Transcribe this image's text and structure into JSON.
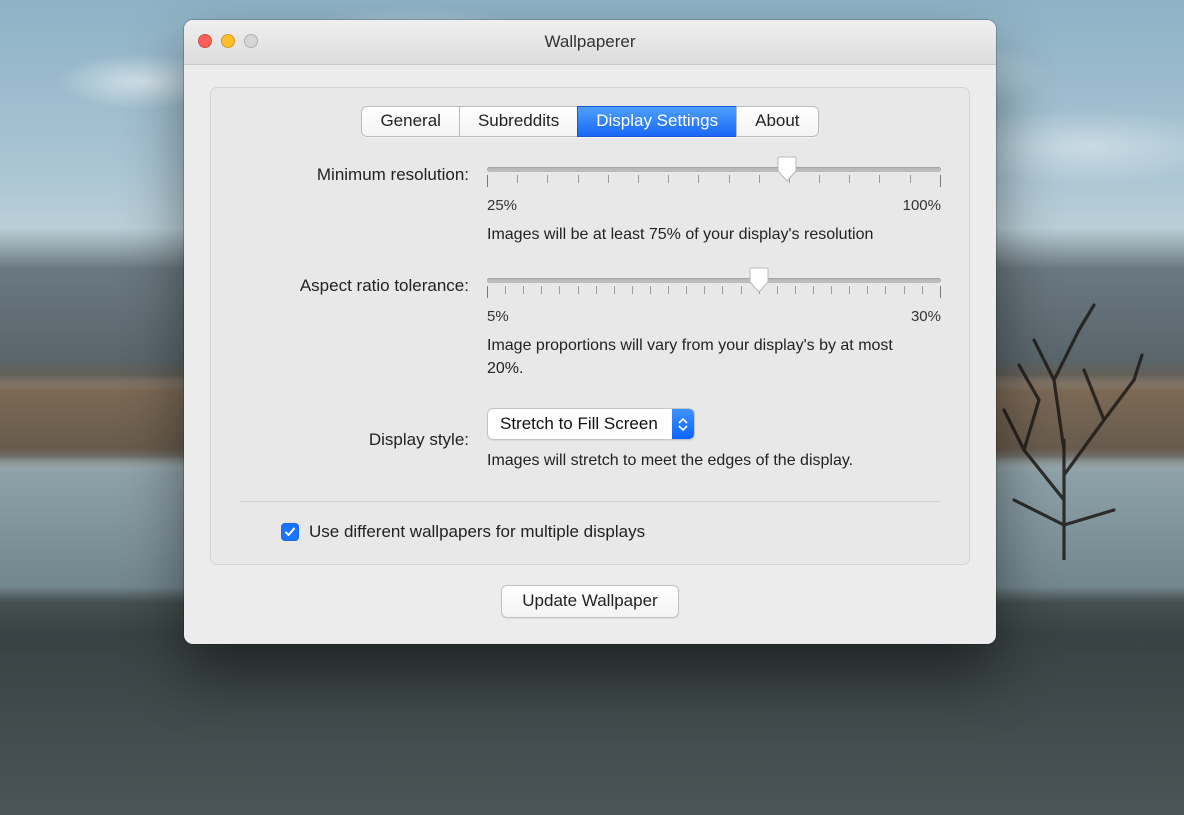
{
  "window": {
    "title": "Wallpaperer"
  },
  "tabs": [
    "General",
    "Subreddits",
    "Display Settings",
    "About"
  ],
  "activeTab": 2,
  "minRes": {
    "label": "Minimum resolution:",
    "minLabel": "25%",
    "maxLabel": "100%",
    "ticks": 16,
    "valuePercentOfTrack": 66,
    "helper": "Images will be at least 75% of your display's resolution"
  },
  "aspect": {
    "label": "Aspect ratio tolerance:",
    "minLabel": "5%",
    "maxLabel": "30%",
    "ticks": 26,
    "valuePercentOfTrack": 60,
    "helper": "Image proportions will vary from your display's by at most 20%."
  },
  "displayStyle": {
    "label": "Display style:",
    "value": "Stretch to Fill Screen",
    "helper": "Images will stretch to meet the edges of the display."
  },
  "multiDisplays": {
    "checked": true,
    "label": "Use different wallpapers for multiple displays"
  },
  "footer": {
    "updateLabel": "Update Wallpaper"
  }
}
